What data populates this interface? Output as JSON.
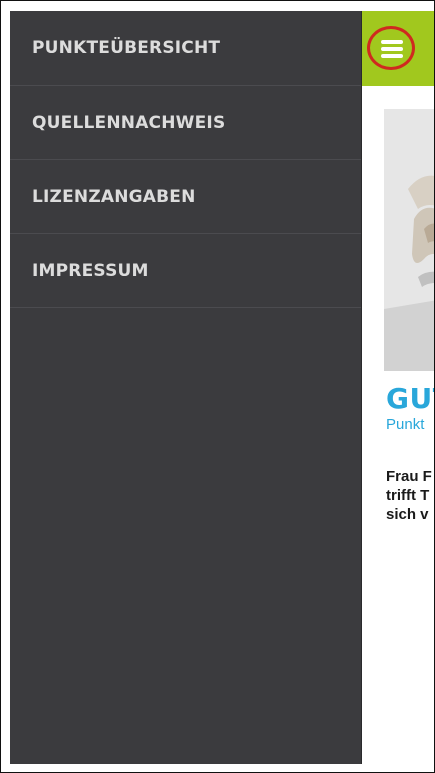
{
  "drawer": {
    "items": [
      {
        "label": "PUNKTEÜBERSICHT"
      },
      {
        "label": "QUELLENNACHWEIS"
      },
      {
        "label": "LIZENZANGABEN"
      },
      {
        "label": "IMPRESSUM"
      }
    ]
  },
  "topbar": {
    "menu_icon": "hamburger-menu-icon",
    "accent_color": "#a1c81e",
    "highlight_color": "#cf2a1f"
  },
  "content": {
    "headline": "GUT",
    "subline": "Punkt",
    "body_lines": [
      "Frau F",
      "trifft T",
      "sich v"
    ],
    "accent_color": "#29a7da"
  }
}
